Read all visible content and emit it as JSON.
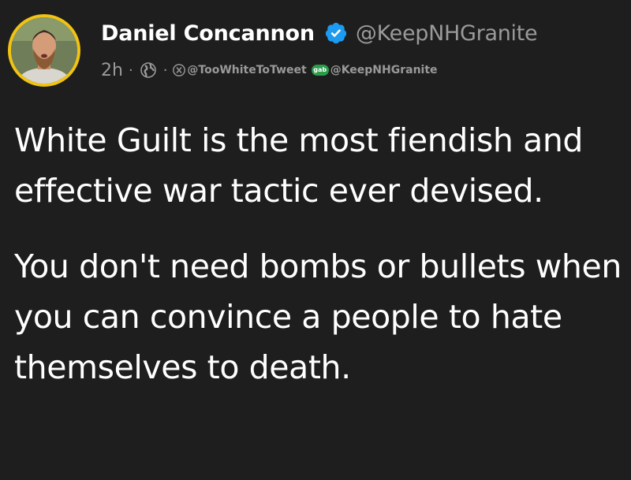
{
  "author": {
    "display_name": "Daniel Concannon",
    "handle": "@KeepNHGranite",
    "verified": true,
    "avatar_ring_color": "#f2c311",
    "verified_color": "#1d9bf0"
  },
  "meta": {
    "time": "2h",
    "separator": "·",
    "visibility_icon": "globe-icon",
    "links": [
      {
        "icon": "x-icon",
        "label": "@TooWhiteToTweet"
      },
      {
        "icon": "gab-icon",
        "icon_text": "gab",
        "label": "@KeepNHGranite"
      }
    ]
  },
  "post": {
    "paragraphs": [
      "White Guilt is the most fiendish and effective war tactic ever devised.",
      "You don't need bombs or bullets when you can convince a people to hate themselves to death."
    ]
  },
  "theme": {
    "background": "#1e1e1e",
    "text": "#ffffff",
    "muted": "#9a9a9a"
  }
}
